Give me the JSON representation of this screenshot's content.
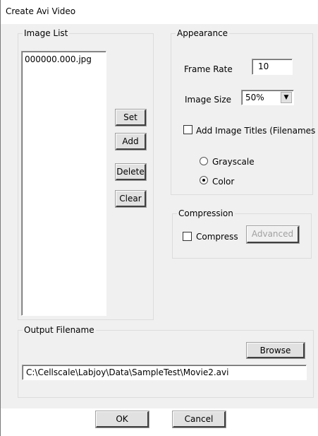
{
  "window": {
    "title": "Create Avi Video"
  },
  "image_list": {
    "legend": "Image List",
    "items": [
      "000000.000.jpg"
    ],
    "buttons": {
      "set": "Set",
      "add": "Add",
      "delete": "Delete",
      "clear": "Clear"
    }
  },
  "appearance": {
    "legend": "Appearance",
    "frame_rate_label": "Frame Rate",
    "frame_rate_value": "10",
    "image_size_label": "Image Size",
    "image_size_value": "50%",
    "add_titles_label": "Add Image Titles (Filenames",
    "add_titles_checked": false,
    "grayscale_label": "Grayscale",
    "color_label": "Color",
    "selected_mode": "Color"
  },
  "compression": {
    "legend": "Compression",
    "compress_label": "Compress",
    "compress_checked": false,
    "advanced_label": "Advanced",
    "advanced_enabled": false
  },
  "output": {
    "legend": "Output Filename",
    "browse_label": "Browse",
    "filename": "C:\\Cellscale\\Labjoy\\Data\\SampleTest\\Movie2.avi"
  },
  "footer": {
    "ok_label": "OK",
    "cancel_label": "Cancel"
  }
}
